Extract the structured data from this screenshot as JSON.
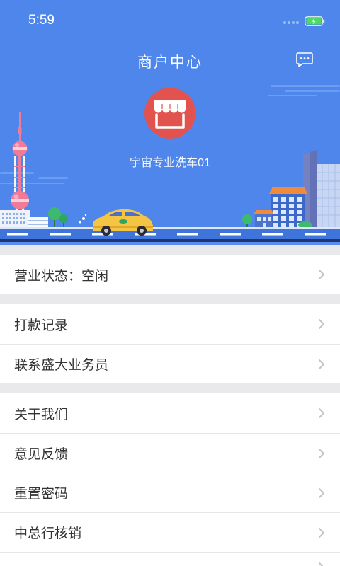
{
  "status_bar": {
    "time": "5:59",
    "battery": {
      "level": 1.0,
      "charging": true
    }
  },
  "header": {
    "title": "商户中心",
    "store": {
      "name": "宇宙专业洗车01"
    }
  },
  "menu_groups": [
    {
      "items": [
        {
          "label": "营业状态：空闲"
        }
      ]
    },
    {
      "items": [
        {
          "label": "打款记录"
        },
        {
          "label": "联系盛大业务员"
        }
      ]
    },
    {
      "items": [
        {
          "label": "关于我们"
        },
        {
          "label": "意见反馈"
        },
        {
          "label": "重置密码"
        },
        {
          "label": "中总行核销"
        }
      ]
    }
  ],
  "icons": {
    "header_action": "message-icon",
    "store_avatar": "store-icon",
    "row_arrow": "chevron-right-icon",
    "battery": "battery-charging-icon",
    "signal": "signal-dots-icon"
  },
  "colors": {
    "header_bg": "#4E86EC",
    "store_bg": "#E2534F",
    "battery_fill": "#4CD964",
    "list_text": "#333333",
    "chevron": "#C4C4C4",
    "page_bg": "#E9E9EB"
  }
}
